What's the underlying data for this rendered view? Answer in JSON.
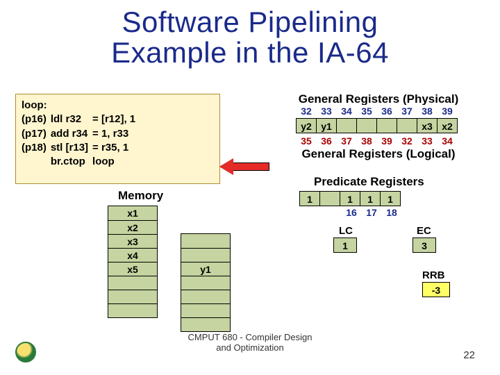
{
  "title_line1": "Software Pipelining",
  "title_line2": "Example in the IA-64",
  "code": {
    "loop_label": "loop:",
    "rows": [
      {
        "pred": "(p16)",
        "op": "ldl  r32",
        "eq": "= [r12], 1"
      },
      {
        "pred": "(p17)",
        "op": "add r34",
        "eq": "= 1, r33"
      },
      {
        "pred": "(p18)",
        "op": "stl  [r13]",
        "eq": "= r35, 1"
      },
      {
        "pred": "",
        "op": "br.ctop",
        "eq": "loop"
      }
    ]
  },
  "memory": {
    "label": "Memory",
    "left": [
      "x1",
      "x2",
      "x3",
      "x4",
      "x5",
      "",
      "",
      ""
    ],
    "right": [
      "",
      "",
      "y1",
      "",
      "",
      "",
      ""
    ]
  },
  "gen_phys_label": "General Registers (Physical)",
  "gen_log_label": "General Registers (Logical)",
  "phys_nums": [
    "32",
    "33",
    "34",
    "35",
    "36",
    "37",
    "38",
    "39"
  ],
  "phys_vals": [
    "y2",
    "y1",
    "",
    "",
    "",
    "",
    "x3",
    "x2"
  ],
  "log_nums": [
    "35",
    "36",
    "37",
    "38",
    "39",
    "32",
    "33",
    "34"
  ],
  "pred_label": "Predicate Registers",
  "pred_vals": [
    "1",
    "",
    "1",
    "1",
    "1"
  ],
  "pred_nums_offset": [
    "16",
    "17",
    "18"
  ],
  "lc": {
    "label": "LC",
    "value": "1"
  },
  "ec": {
    "label": "EC",
    "value": "3"
  },
  "rrb": {
    "label": "RRB",
    "value": "-3"
  },
  "footer_line1": "CMPUT 680 - Compiler Design",
  "footer_line2": "and Optimization",
  "page": "22"
}
